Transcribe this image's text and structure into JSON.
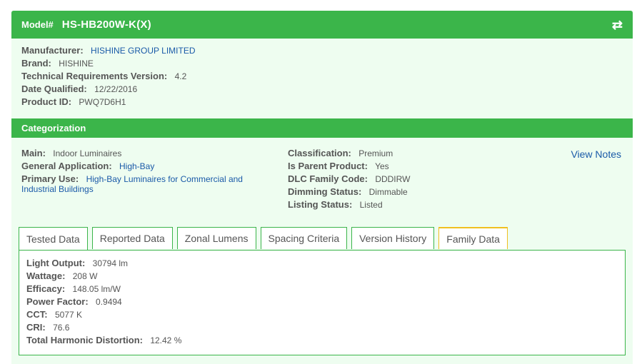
{
  "header": {
    "model_label": "Model#",
    "model_value": "HS-HB200W-K(X)",
    "swap_icon": "swap-arrows-icon"
  },
  "info": {
    "manufacturer": {
      "label": "Manufacturer:",
      "value": "HISHINE GROUP LIMITED"
    },
    "brand": {
      "label": "Brand:",
      "value": "HISHINE"
    },
    "tech_req": {
      "label": "Technical Requirements Version:",
      "value": "4.2"
    },
    "date_qualified": {
      "label": "Date Qualified:",
      "value": "12/22/2016"
    },
    "product_id": {
      "label": "Product ID:",
      "value": "PWQ7D6H1"
    }
  },
  "categorization": {
    "title": "Categorization",
    "main": {
      "label": "Main:",
      "value": "Indoor Luminaires"
    },
    "general_application": {
      "label": "General Application:",
      "value": "High-Bay"
    },
    "primary_use": {
      "label": "Primary Use:",
      "value": "High-Bay Luminaires for Commercial and Industrial Buildings"
    },
    "classification": {
      "label": "Classification:",
      "value": "Premium"
    },
    "is_parent": {
      "label": "Is Parent Product:",
      "value": "Yes"
    },
    "dlc_family": {
      "label": "DLC Family Code:",
      "value": "DDDIRW"
    },
    "dimming": {
      "label": "Dimming Status:",
      "value": "Dimmable"
    },
    "listing": {
      "label": "Listing Status:",
      "value": "Listed"
    },
    "view_notes": "View Notes"
  },
  "tabs": [
    "Tested Data",
    "Reported Data",
    "Zonal Lumens",
    "Spacing Criteria",
    "Version History",
    "Family Data"
  ],
  "tested": {
    "light_output": {
      "label": "Light Output:",
      "value": "30794 lm"
    },
    "wattage": {
      "label": "Wattage:",
      "value": "208 W"
    },
    "efficacy": {
      "label": "Efficacy:",
      "value": "148.05 lm/W"
    },
    "power_factor": {
      "label": "Power Factor:",
      "value": "0.9494"
    },
    "cct": {
      "label": "CCT:",
      "value": "5077 K"
    },
    "cri": {
      "label": "CRI:",
      "value": "76.6"
    },
    "thd": {
      "label": "Total Harmonic Distortion:",
      "value": "12.42 %"
    }
  }
}
